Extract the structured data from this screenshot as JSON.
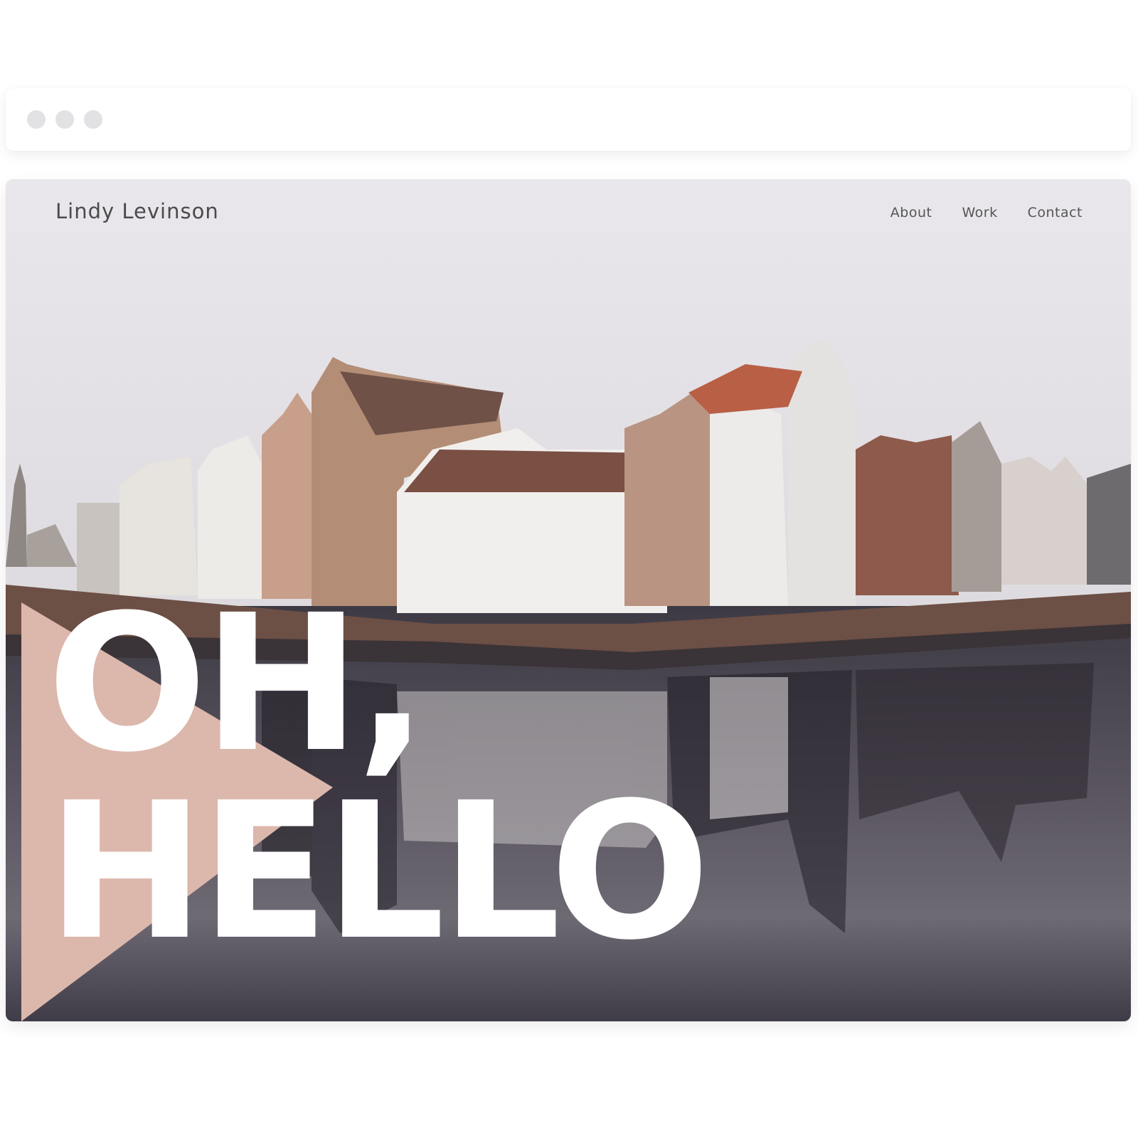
{
  "browser": {
    "window_dots": [
      "dot",
      "dot",
      "dot"
    ]
  },
  "site": {
    "brand": "Lindy Levinson",
    "nav": {
      "about": "About",
      "work": "Work",
      "contact": "Contact"
    },
    "hero": {
      "line1": "OH,",
      "line2": "HELLO"
    },
    "background": "canal-townhouses-photo"
  },
  "colors": {
    "accent_triangle": "#dcb7ac",
    "sky": "#e8e6ea",
    "text_dark": "#4a4a4c",
    "hero_text": "#ffffff"
  }
}
